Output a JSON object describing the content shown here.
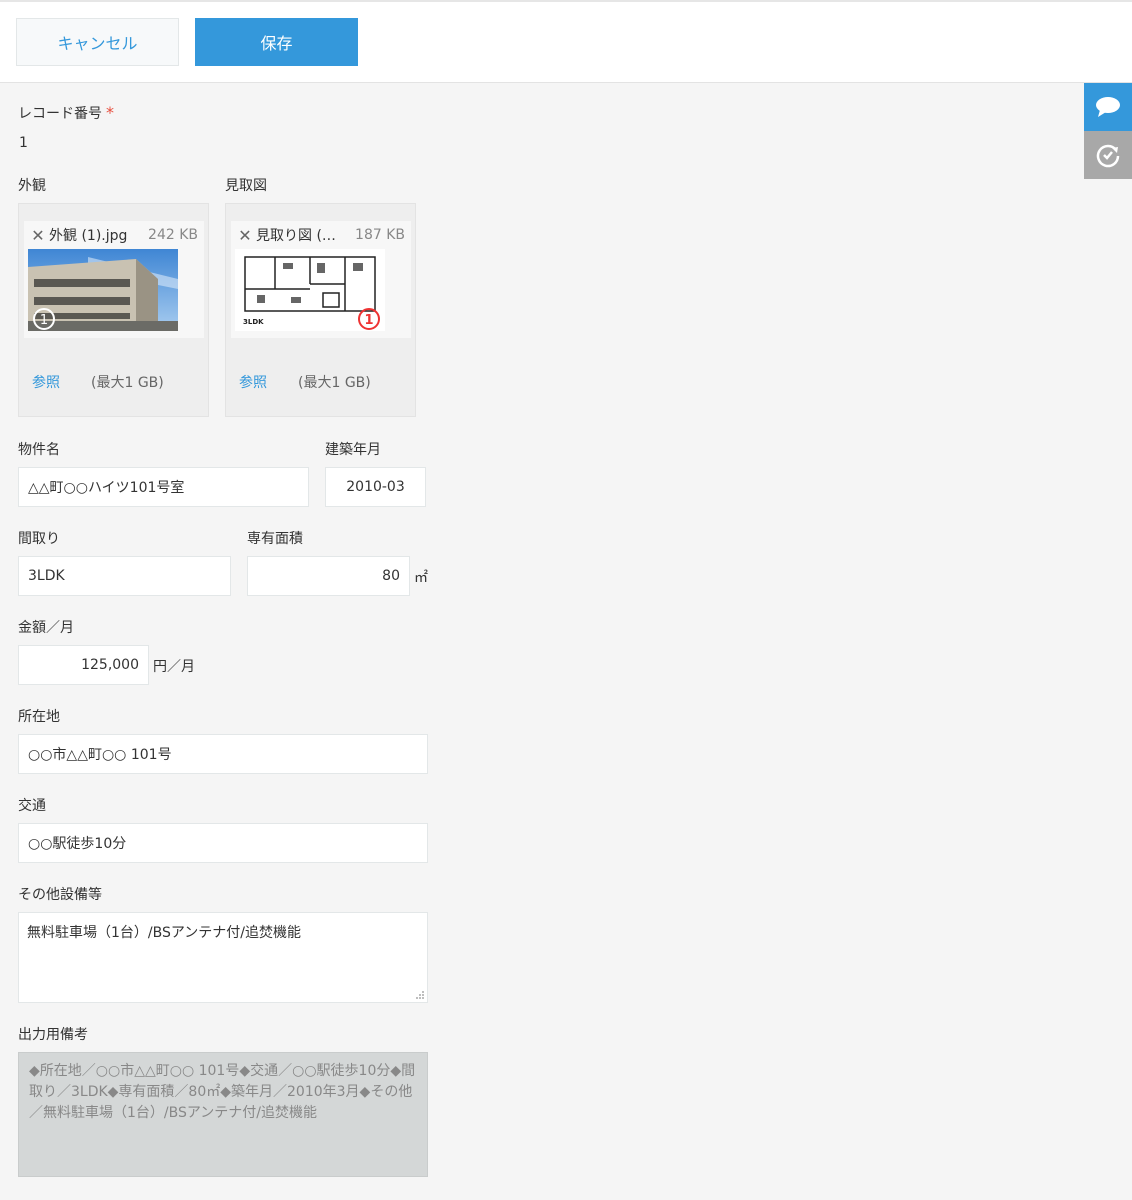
{
  "toolbar": {
    "cancel_label": "キャンセル",
    "save_label": "保存"
  },
  "side": {
    "comment_icon": "comment-icon",
    "history_icon": "history-icon"
  },
  "record": {
    "label": "レコード番号",
    "required_mark": "*",
    "value": "1"
  },
  "files": {
    "exterior": {
      "label": "外観",
      "filename": "外観 (1).jpg",
      "size": "242 KB",
      "browse": "参照",
      "limit": "(最大1 GB)"
    },
    "floorplan": {
      "label": "見取図",
      "filename": "見取り図 (…",
      "size": "187 KB",
      "browse": "参照",
      "limit": "(最大1 GB)",
      "caption": "3LDK",
      "badge": "1"
    }
  },
  "fields": {
    "property_name": {
      "label": "物件名",
      "value": "△△町○○ハイツ101号室"
    },
    "built": {
      "label": "建築年月",
      "value": "2010-03"
    },
    "layout": {
      "label": "間取り",
      "value": "3LDK"
    },
    "area": {
      "label": "専有面積",
      "value": "80",
      "unit": "㎡"
    },
    "rent": {
      "label": "金額／月",
      "value": "125,000",
      "unit": "円／月"
    },
    "address": {
      "label": "所在地",
      "value": "○○市△△町○○ 101号"
    },
    "access": {
      "label": "交通",
      "value": "○○駅徒歩10分"
    },
    "facilities": {
      "label": "その他設備等",
      "value": "無料駐車場（1台）/BSアンテナ付/追焚機能"
    },
    "output_notes": {
      "label": "出力用備考",
      "value": "◆所在地／○○市△△町○○ 101号◆交通／○○駅徒歩10分◆間取り／3LDK◆専有面積／80㎡◆築年月／2010年3月◆その他／無料駐車場（1台）/BSアンテナ付/追焚機能"
    }
  },
  "colors": {
    "accent": "#3498db",
    "required": "#e74c3c",
    "background": "#f5f5f5"
  }
}
